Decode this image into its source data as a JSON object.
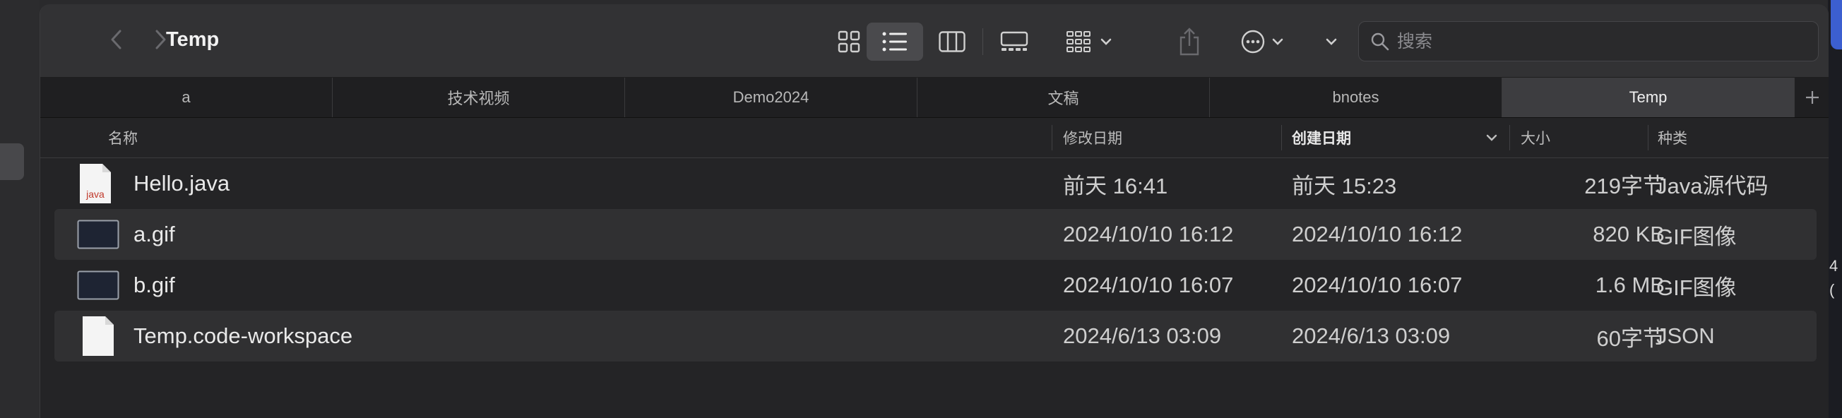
{
  "window": {
    "title": "Temp"
  },
  "toolbar": {
    "back_icon": "chevron-left-icon",
    "forward_icon": "chevron-right-icon",
    "view_icons": [
      "icon-view-icon",
      "list-view-icon",
      "column-view-icon",
      "gallery-view-icon"
    ],
    "group_icon": "group-by-icon",
    "share_icon": "share-icon",
    "more_icon": "ellipsis-circle-icon"
  },
  "search": {
    "placeholder": "搜索",
    "value": ""
  },
  "tabs": [
    {
      "label": "a"
    },
    {
      "label": "技术视频"
    },
    {
      "label": "Demo2024"
    },
    {
      "label": "文稿"
    },
    {
      "label": "bnotes"
    },
    {
      "label": "Temp",
      "active": true
    }
  ],
  "columns": {
    "name": "名称",
    "modified": "修改日期",
    "created": "创建日期",
    "size": "大小",
    "kind": "种类"
  },
  "files": [
    {
      "name": "Hello.java",
      "modified": "前天 16:41",
      "created": "前天 15:23",
      "size": "219字节",
      "kind": "Java源代码",
      "icon": "java-file-icon",
      "icon_label": "java"
    },
    {
      "name": "a.gif",
      "modified": "2024/10/10 16:12",
      "created": "2024/10/10 16:12",
      "size": "820 KB",
      "kind": "GIF图像",
      "icon": "gif-thumbnail-icon"
    },
    {
      "name": "b.gif",
      "modified": "2024/10/10 16:07",
      "created": "2024/10/10 16:07",
      "size": "1.6 MB",
      "kind": "GIF图像",
      "icon": "gif-thumbnail-icon"
    },
    {
      "name": "Temp.code-workspace",
      "modified": "2024/6/13 03:09",
      "created": "2024/6/13 03:09",
      "size": "60字节",
      "kind": "JSON",
      "icon": "document-icon"
    }
  ],
  "edge": {
    "digits": "4\n("
  },
  "colors": {
    "accent": "#3c5fd0",
    "window_bg": "#242426",
    "toolbar_bg": "#323234",
    "java_red": "#c0392b"
  }
}
